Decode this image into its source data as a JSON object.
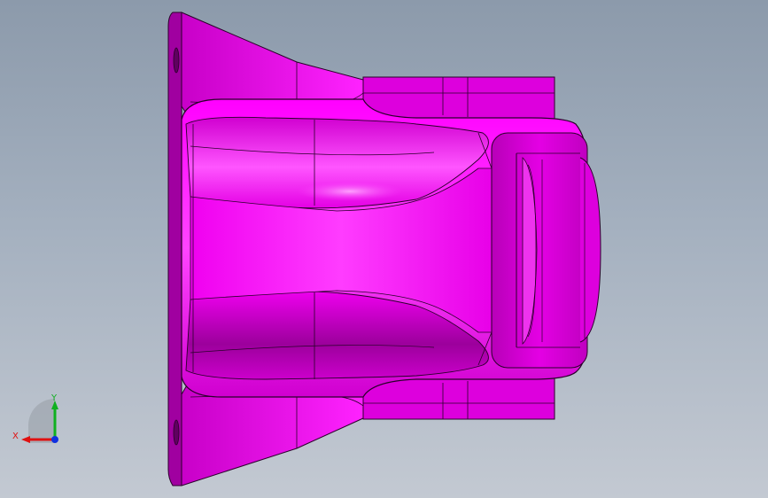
{
  "viewport": {
    "background_top": "#8c9aab",
    "background_bottom": "#c3c9d2",
    "part_color": "#ff00ff",
    "edge_color": "#2a002a"
  },
  "triad": {
    "x_label": "X",
    "y_label": "Y",
    "x_color": "#e01010",
    "y_color": "#10b020",
    "z_color": "#1030e0"
  }
}
